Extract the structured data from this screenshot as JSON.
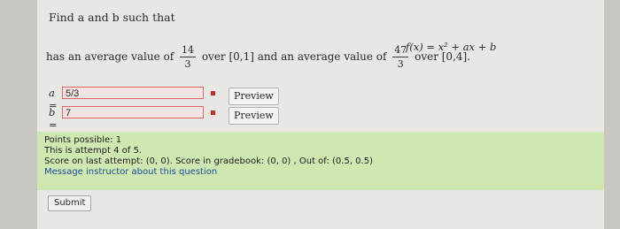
{
  "question": {
    "prompt": "Find a and b such that",
    "function": "f(x) = x² + ax + b",
    "avg_text_1": "has an average value of",
    "frac1": {
      "num": "14",
      "den": "3"
    },
    "avg_text_2": "over [0,1] and an average value of",
    "frac2": {
      "num": "47",
      "den": "3"
    },
    "avg_text_3": "over [0,4]."
  },
  "answers": {
    "a_label": "a =",
    "a_value": "5/3",
    "b_label": "b =",
    "b_value": "7"
  },
  "buttons": {
    "preview_a": "Preview",
    "preview_b": "Preview",
    "submit": "Submit"
  },
  "info": {
    "points": "Points possible: 1",
    "attempt": "This is attempt 4 of 5.",
    "last_attempt": "Score on last attempt: (0, 0). Score in gradebook: (0, 0) , Out of: (0.5, 0.5)",
    "message": "Message instructor about this question"
  }
}
